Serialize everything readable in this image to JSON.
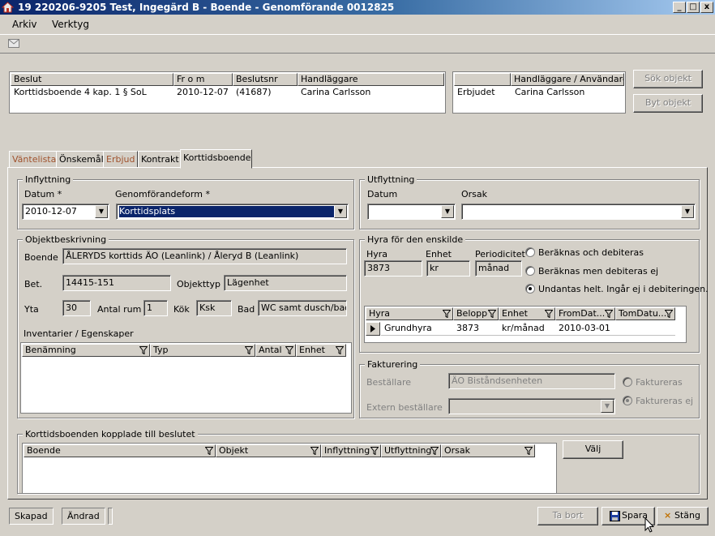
{
  "window": {
    "title": "19 220206-9205  Test, Ingegärd B   -  Boende - Genomförande  0012825",
    "buttons": [
      "_",
      "□",
      "x"
    ]
  },
  "menu": [
    "Arkiv",
    "Verktyg"
  ],
  "beslut_grid": {
    "headers": [
      "Beslut",
      "Fr o m",
      "Beslutsnr",
      "Handläggare"
    ],
    "row": [
      "Korttidsboende  4 kap. 1 § SoL",
      "2010-12-07",
      "(41687)",
      "Carina Carlsson"
    ]
  },
  "handlaggare_grid": {
    "headers": [
      "",
      "Handläggare / Användare"
    ],
    "row": [
      "Erbjudet",
      "Carina Carlsson"
    ]
  },
  "side_buttons": {
    "sok": "Sök objekt",
    "byt": "Byt objekt"
  },
  "tabs": [
    {
      "label": "Väntelista",
      "color": "#a0522d"
    },
    {
      "label": "Önskemål",
      "color": "#000000"
    },
    {
      "label": "Erbjud",
      "color": "#a0522d"
    },
    {
      "label": "Kontrakt",
      "color": "#000000"
    },
    {
      "label": "Korttidsboende",
      "color": "#000000"
    }
  ],
  "inflyttning": {
    "group": "Inflyttning",
    "datum_label": "Datum *",
    "datum_value": "2010-12-07",
    "form_label": "Genomförandeform *",
    "form_value": "Korttidsplats"
  },
  "utflyttning": {
    "group": "Utflyttning",
    "datum_label": "Datum",
    "datum_value": "",
    "orsak_label": "Orsak",
    "orsak_value": ""
  },
  "objekt": {
    "group": "Objektbeskrivning",
    "boende_label": "Boende",
    "boende_value": "ÅLERYDS korttids ÄO (Leanlink) / Åleryd B (Leanlink)",
    "bet_label": "Bet.",
    "bet_value": "14415-151",
    "objekttyp_label": "Objekttyp",
    "objekttyp_value": "Lägenhet",
    "yta_label": "Yta",
    "yta_value": "30",
    "rum_label": "Antal rum",
    "rum_value": "1",
    "kok_label": "Kök",
    "kok_value": "Ksk",
    "bad_label": "Bad",
    "bad_value": "WC samt dusch/bad",
    "inventarier_label": "Inventarier / Egenskaper",
    "inv_headers": [
      "Benämning",
      "Typ",
      "Antal",
      "Enhet"
    ]
  },
  "hyra": {
    "group": "Hyra för den enskilde",
    "hyra_label": "Hyra",
    "hyra_value": "3873",
    "enhet_label": "Enhet",
    "enhet_value": "kr",
    "period_label": "Periodicitet",
    "period_value": "månad",
    "radios": [
      {
        "label": "Beräknas och debiteras",
        "checked": false
      },
      {
        "label": "Beräknas men debiteras ej",
        "checked": false
      },
      {
        "label": "Undantas helt. Ingår ej i debiteringen.",
        "checked": true
      }
    ],
    "grid_headers": [
      "Hyra",
      "Belopp",
      "Enhet",
      "FromDat...",
      "TomDatu..."
    ],
    "grid_row": [
      "Grundhyra",
      "3873",
      "kr/månad",
      "2010-03-01",
      ""
    ]
  },
  "fakturering": {
    "group": "Fakturering",
    "bestallare_label": "Beställare",
    "bestallare_value": "ÄO Biståndsenheten",
    "extern_label": "Extern beställare",
    "extern_value": "",
    "radio_faktureras": "Faktureras",
    "radio_faktureras_ej": "Faktureras ej"
  },
  "kopplade": {
    "group": "Korttidsboenden kopplade till beslutet",
    "headers": [
      "Boende",
      "Objekt",
      "Inflyttning",
      "Utflyttning",
      "Orsak"
    ],
    "valj": "Välj"
  },
  "statusbar": {
    "skapad": "Skapad",
    "andrad": "Ändrad"
  },
  "bottom_buttons": {
    "ta_bort": "Ta bort",
    "spara": "Spara",
    "stang": "Stäng"
  }
}
